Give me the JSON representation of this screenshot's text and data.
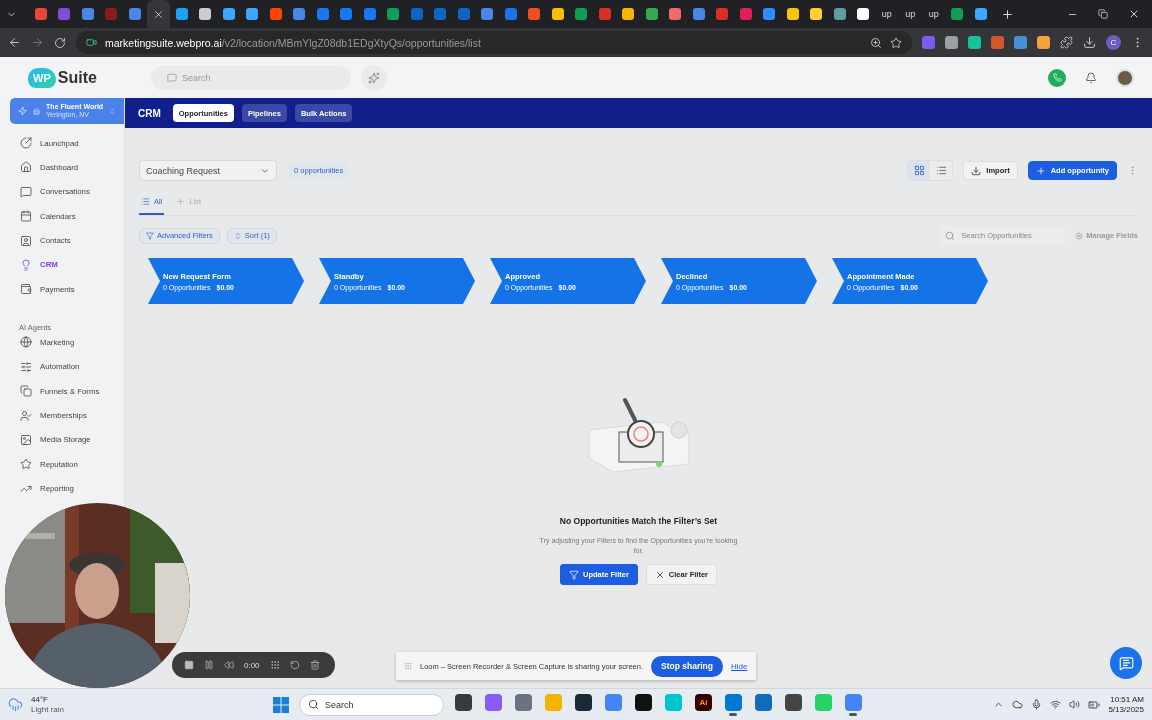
{
  "browser": {
    "tabs": [
      {
        "kind": "icon",
        "color": "#e8453c",
        "selected": false
      },
      {
        "kind": "icon",
        "color": "#7b4fd6",
        "selected": false
      },
      {
        "kind": "icon",
        "color": "#4a86e8",
        "selected": false
      },
      {
        "kind": "icon",
        "color": "#8b1a1a",
        "selected": false
      },
      {
        "kind": "icon",
        "color": "#4a86e8",
        "selected": false
      },
      {
        "kind": "icon",
        "selected": true
      },
      {
        "kind": "icon",
        "color": "#1da1f2",
        "selected": false
      },
      {
        "kind": "icon",
        "color": "#cccccc",
        "selected": false
      },
      {
        "kind": "icon",
        "color": "#3ea6ff",
        "selected": false
      },
      {
        "kind": "icon",
        "color": "#3ea6ff",
        "selected": false
      },
      {
        "kind": "icon",
        "color": "#ff4500",
        "selected": false
      },
      {
        "kind": "icon",
        "color": "#4a86e8",
        "selected": false
      },
      {
        "kind": "icon",
        "color": "#1877f2",
        "selected": false
      },
      {
        "kind": "icon",
        "color": "#1877f2",
        "selected": false
      },
      {
        "kind": "icon",
        "color": "#1877f3",
        "selected": false
      },
      {
        "kind": "icon",
        "color": "#0f9d58",
        "selected": false
      },
      {
        "kind": "icon",
        "color": "#0a66c2",
        "selected": false
      },
      {
        "kind": "icon",
        "color": "#0a66c2",
        "selected": false
      },
      {
        "kind": "icon",
        "color": "#0a66c2",
        "selected": false
      },
      {
        "kind": "icon",
        "color": "#4a86e8",
        "selected": false
      },
      {
        "kind": "icon",
        "color": "#1a73e8",
        "selected": false
      },
      {
        "kind": "icon",
        "color": "#f25022",
        "selected": false
      },
      {
        "kind": "icon",
        "color": "#fbbc04",
        "selected": false
      },
      {
        "kind": "icon",
        "color": "#0f9d58",
        "selected": false
      },
      {
        "kind": "icon",
        "color": "#d93025",
        "selected": false
      },
      {
        "kind": "icon",
        "color": "#f4b400",
        "selected": false
      },
      {
        "kind": "icon",
        "color": "#34a853",
        "selected": false
      },
      {
        "kind": "icon",
        "color": "#f06a6a",
        "selected": false
      },
      {
        "kind": "icon",
        "color": "#4a86e8",
        "selected": false
      },
      {
        "kind": "icon",
        "color": "#d93025",
        "selected": false
      },
      {
        "kind": "icon",
        "color": "#e01e5a",
        "selected": false
      },
      {
        "kind": "icon",
        "color": "#2d8cff",
        "selected": false
      },
      {
        "kind": "icon",
        "color": "#f7c600",
        "selected": false
      },
      {
        "kind": "icon",
        "color": "#ffd02f",
        "selected": false
      },
      {
        "kind": "icon",
        "color": "#5f9ea0",
        "selected": false
      },
      {
        "kind": "icon",
        "color": "#ffffff",
        "selected": false
      },
      {
        "kind": "text",
        "label": "up",
        "selected": false
      },
      {
        "kind": "text",
        "label": "up",
        "selected": false
      },
      {
        "kind": "text",
        "label": "up",
        "selected": false
      },
      {
        "kind": "icon",
        "color": "#0f9d58",
        "selected": false
      },
      {
        "kind": "icon",
        "color": "#3ea6ff",
        "selected": false
      }
    ],
    "url_host": "marketingsuite.webpro.ai",
    "url_path": "/v2/location/MBmYlgZ08db1EDgXtyQs/opportunities/list",
    "profile_initial": "C"
  },
  "logo": {
    "badge": "WP",
    "name": "Suite"
  },
  "search": {
    "placeholder": "Search"
  },
  "account": {
    "name": "The Fluent World",
    "location": "Yerington, NV"
  },
  "nav": [
    {
      "label": "Launchpad",
      "selected": false
    },
    {
      "label": "Dashboard",
      "selected": false
    },
    {
      "label": "Conversations",
      "selected": false
    },
    {
      "label": "Calendars",
      "selected": false
    },
    {
      "label": "Contacts",
      "selected": false
    },
    {
      "label": "CRM",
      "selected": true
    },
    {
      "label": "Payments",
      "selected": false
    }
  ],
  "nav_section": "AI Agents",
  "nav_more": [
    {
      "label": "Marketing",
      "selected": false
    },
    {
      "label": "Automation",
      "selected": false
    },
    {
      "label": "Funnels & Forms",
      "selected": false
    },
    {
      "label": "Memberships",
      "selected": false
    },
    {
      "label": "Media Storage",
      "selected": false
    },
    {
      "label": "Reputation",
      "selected": false
    },
    {
      "label": "Reporting",
      "selected": false
    }
  ],
  "module": {
    "title": "CRM",
    "tabs": [
      {
        "label": "Opportunities",
        "selected": true
      },
      {
        "label": "Pipelines",
        "selected": false
      },
      {
        "label": "Bulk Actions",
        "selected": false
      }
    ]
  },
  "pipeline": {
    "value": "Coaching Request",
    "count": "0 opportunities"
  },
  "views": [
    {
      "kind": "board",
      "selected": true
    },
    {
      "kind": "list",
      "selected": false
    }
  ],
  "actions": {
    "import": "Import",
    "add": "Add opportunity"
  },
  "subtabs": [
    {
      "kind": "all",
      "label": "All",
      "selected": true
    },
    {
      "kind": "new",
      "label": "List",
      "selected": false
    }
  ],
  "filters": {
    "advanced": "Advanced Filters",
    "sort": "Sort (1)"
  },
  "opportunity_search": {
    "placeholder": "Search Opportunities"
  },
  "manage_fields": {
    "label": "Manage Fields",
    "disabled": true
  },
  "stages": [
    {
      "name": "New Request Form",
      "count": "0 Opportunities",
      "amount": "$0.00"
    },
    {
      "name": "Standby",
      "count": "0 Opportunities",
      "amount": "$0.00"
    },
    {
      "name": "Approved",
      "count": "0 Opportunities",
      "amount": "$0.00"
    },
    {
      "name": "Declined",
      "count": "0 Opportunities",
      "amount": "$0.00"
    },
    {
      "name": "Appointment Made",
      "count": "0 Opportunities",
      "amount": "$0.00"
    }
  ],
  "empty": {
    "title": "No Opportunities Match the Filter’s Set",
    "text": "Try adjusting your Filters to find the Opportunities you’re looking for.",
    "primary": "Update Filter",
    "secondary": "Clear Filter"
  },
  "recorder": {
    "time": "0:00"
  },
  "loom": {
    "message": "Loom – Screen Recorder & Screen Capture is sharing your screen.",
    "stop": "Stop sharing",
    "hide": "Hide"
  },
  "taskbar": {
    "weather": {
      "temp": "44°F",
      "condition": "Light rain"
    },
    "search": "Search",
    "apps": [
      {
        "color": "#3a3a3a",
        "active": false
      },
      {
        "color": "#8a5cf6",
        "active": false
      },
      {
        "color": "#6b7280",
        "active": false
      },
      {
        "color": "#f4b400",
        "active": false
      },
      {
        "color": "#1b2838",
        "active": false
      },
      {
        "color": "#4285f4",
        "active": false
      },
      {
        "color": "#111111",
        "active": false
      },
      {
        "color": "#00c4cc",
        "active": false
      },
      {
        "color": "#330000",
        "label": "Ai",
        "active": false
      },
      {
        "color": "#0078d4",
        "active": true
      },
      {
        "color": "#0f6cbd",
        "active": false
      },
      {
        "color": "#444444",
        "active": false
      },
      {
        "color": "#25d366",
        "active": false
      },
      {
        "color": "#4285f5",
        "active": true
      }
    ],
    "time": "10:51 AM",
    "date": "5/13/2025"
  }
}
